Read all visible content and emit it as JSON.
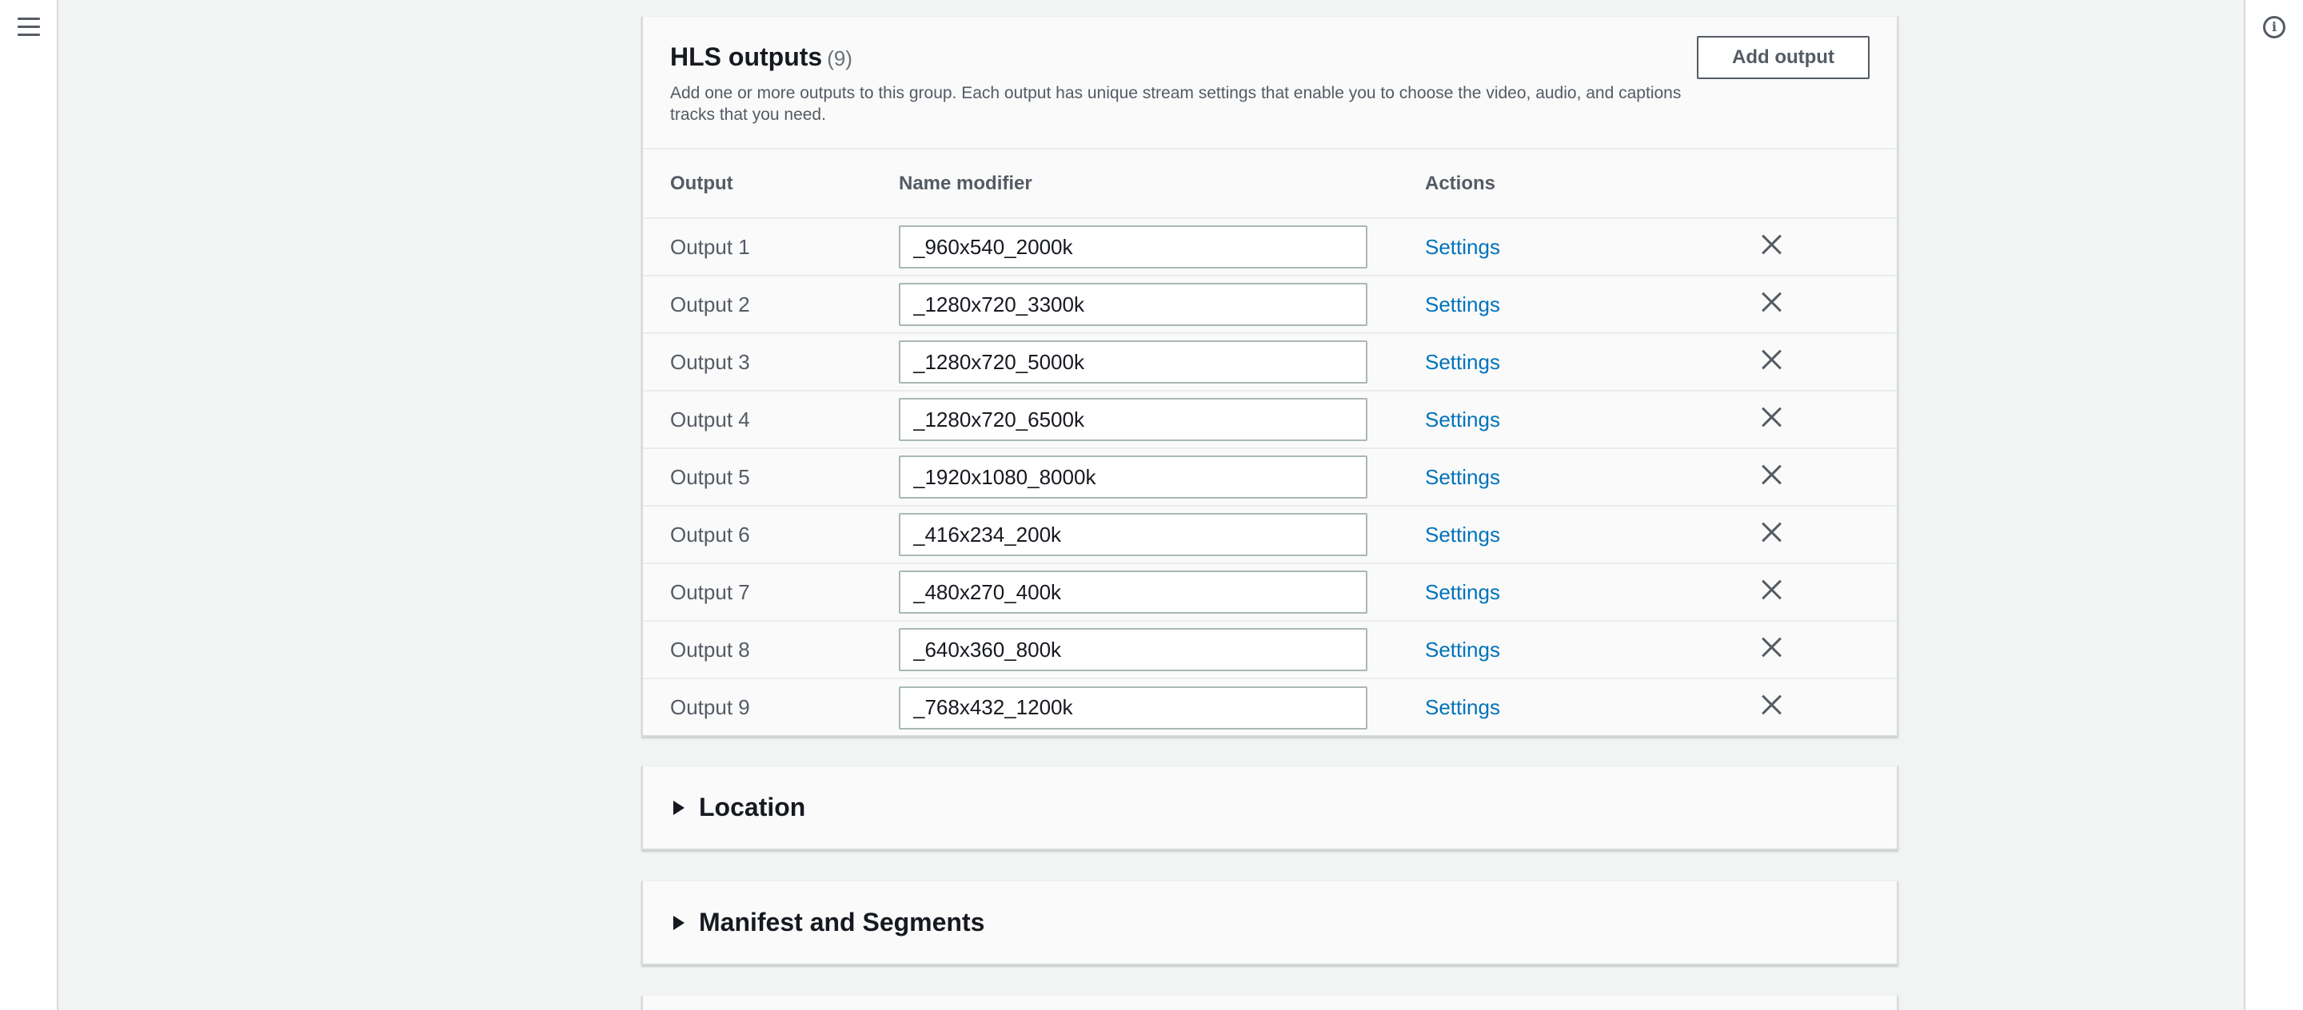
{
  "hls_outputs": {
    "title": "HLS outputs",
    "count": "(9)",
    "description": "Add one or more outputs to this group. Each output has unique stream settings that enable you to choose the video, audio, and captions tracks that you need.",
    "add_button_label": "Add output",
    "columns": {
      "output": "Output",
      "name_modifier": "Name modifier",
      "actions": "Actions"
    },
    "settings_label": "Settings",
    "rows": [
      {
        "output": "Output 1",
        "name_modifier": "_960x540_2000k"
      },
      {
        "output": "Output 2",
        "name_modifier": "_1280x720_3300k"
      },
      {
        "output": "Output 3",
        "name_modifier": "_1280x720_5000k"
      },
      {
        "output": "Output 4",
        "name_modifier": "_1280x720_6500k"
      },
      {
        "output": "Output 5",
        "name_modifier": "_1920x1080_8000k"
      },
      {
        "output": "Output 6",
        "name_modifier": "_416x234_200k"
      },
      {
        "output": "Output 7",
        "name_modifier": "_480x270_400k"
      },
      {
        "output": "Output 8",
        "name_modifier": "_640x360_800k"
      },
      {
        "output": "Output 9",
        "name_modifier": "_768x432_1200k"
      }
    ]
  },
  "sections": {
    "location": "Location",
    "manifest_and_segments": "Manifest and Segments"
  },
  "icons": {
    "menu": "menu-icon",
    "info": "info-icon",
    "remove": "close-icon",
    "expand": "caret-right-icon"
  },
  "colors": {
    "link": "#0073bb",
    "text": "#16191f",
    "secondary": "#545b64",
    "border": "#d5dbdb"
  }
}
